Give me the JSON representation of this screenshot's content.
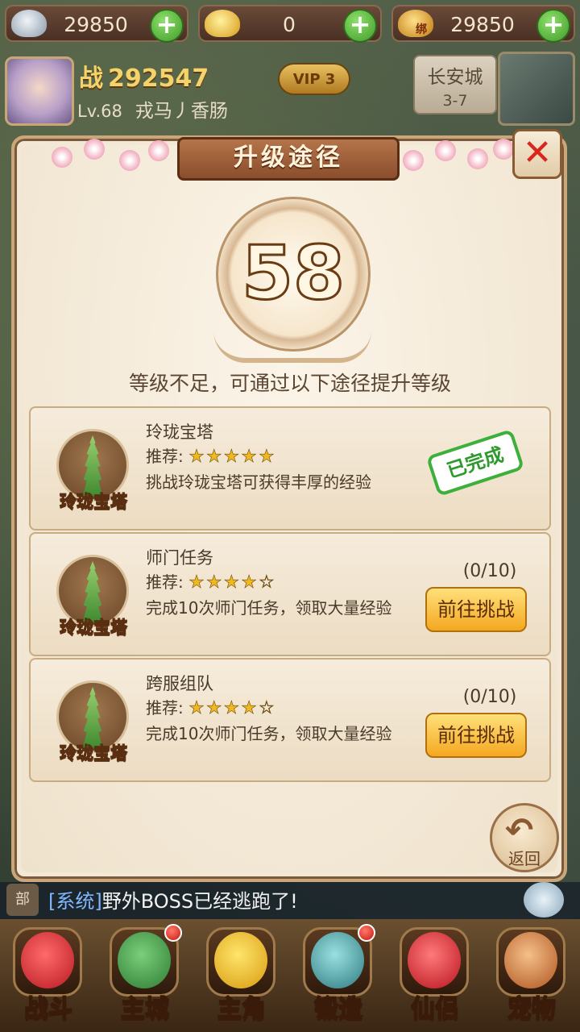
{
  "currency": [
    {
      "icon": "silver-ingot-icon",
      "value": "29850"
    },
    {
      "icon": "gold-ingot-icon",
      "value": "0"
    },
    {
      "icon": "bound-gold-ingot-icon",
      "value": "29850",
      "badge": "绑"
    }
  ],
  "player": {
    "power_prefix": "战",
    "power": "292547",
    "level": "Lv.68",
    "name": "戎马丿香肠",
    "vip": "VIP 3"
  },
  "location": {
    "city": "长安城",
    "stage": "3-7"
  },
  "dialog": {
    "title": "升级途径",
    "level": "58",
    "hint": "等级不足，可通过以下途径提升等级",
    "back_label": "返回",
    "close": "✕"
  },
  "routes": [
    {
      "name": "玲珑宝塔",
      "rec_label": "推荐:",
      "stars": "★★★★★",
      "rating": 5,
      "desc": "挑战玲珑宝塔可获得丰厚的经验",
      "icon_label": "玲珑宝塔",
      "status": "已完成"
    },
    {
      "name": "师门任务",
      "rec_label": "推荐:",
      "stars": "★★★★☆",
      "rating": 4,
      "desc": "完成10次师门任务，领取大量经验",
      "icon_label": "玲珑宝塔",
      "progress": "(0/10)",
      "button": "前往挑战"
    },
    {
      "name": "跨服组队",
      "rec_label": "推荐:",
      "stars": "★★★★☆",
      "rating": 4,
      "desc": "完成10次师门任务，领取大量经验",
      "icon_label": "玲珑宝塔",
      "progress": "(0/10)",
      "button": "前往挑战"
    }
  ],
  "chat": {
    "tab": "部",
    "tag": "[系统]",
    "message": "野外BOSS已经逃跑了!"
  },
  "nav": [
    {
      "label": "战斗",
      "icon": "battle-icon",
      "color": "#d8303a"
    },
    {
      "label": "主城",
      "icon": "main-city-icon",
      "color": "#3e9a48"
    },
    {
      "label": "主角",
      "icon": "hero-icon",
      "color": "#f2c22a"
    },
    {
      "label": "锻造",
      "icon": "forge-hammer-icon",
      "color": "#4aa0a8"
    },
    {
      "label": "仙侣",
      "icon": "partner-heart-icon",
      "color": "#d8303a"
    },
    {
      "label": "宠物",
      "icon": "pet-monkey-icon",
      "color": "#c86a2a"
    }
  ]
}
